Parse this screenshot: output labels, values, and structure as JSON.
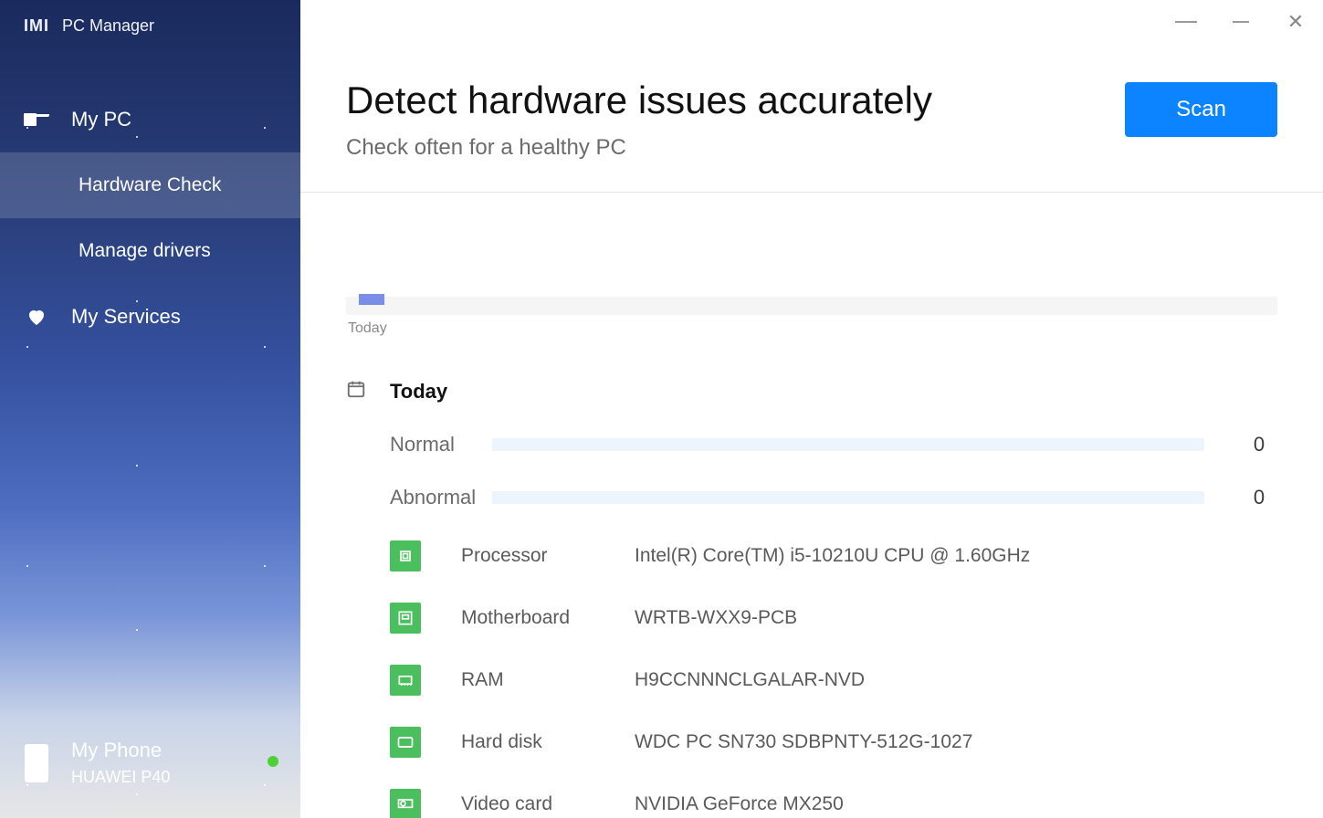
{
  "app": {
    "title": "PC Manager"
  },
  "sidebar": {
    "items": [
      {
        "label": "My PC"
      },
      {
        "label": "Hardware Check"
      },
      {
        "label": "Manage drivers"
      },
      {
        "label": "My Services"
      }
    ],
    "phone": {
      "title": "My Phone",
      "model": "HUAWEI P40"
    }
  },
  "header": {
    "title": "Detect hardware issues accurately",
    "subtitle": "Check often for a healthy PC",
    "scan_label": "Scan"
  },
  "timeline": {
    "label": "Today"
  },
  "section": {
    "title": "Today",
    "statuses": [
      {
        "label": "Normal",
        "count": "0"
      },
      {
        "label": "Abnormal",
        "count": "0"
      }
    ],
    "hardware": [
      {
        "icon": "cpu",
        "label": "Processor",
        "value": "Intel(R) Core(TM) i5-10210U CPU @ 1.60GHz"
      },
      {
        "icon": "board",
        "label": "Motherboard",
        "value": "WRTB-WXX9-PCB"
      },
      {
        "icon": "ram",
        "label": "RAM",
        "value": "H9CCNNNCLGALAR-NVD"
      },
      {
        "icon": "disk",
        "label": "Hard disk",
        "value": "WDC PC SN730 SDBPNTY-512G-1027"
      },
      {
        "icon": "gpu",
        "label": "Video card",
        "value": "NVIDIA GeForce MX250"
      }
    ]
  }
}
